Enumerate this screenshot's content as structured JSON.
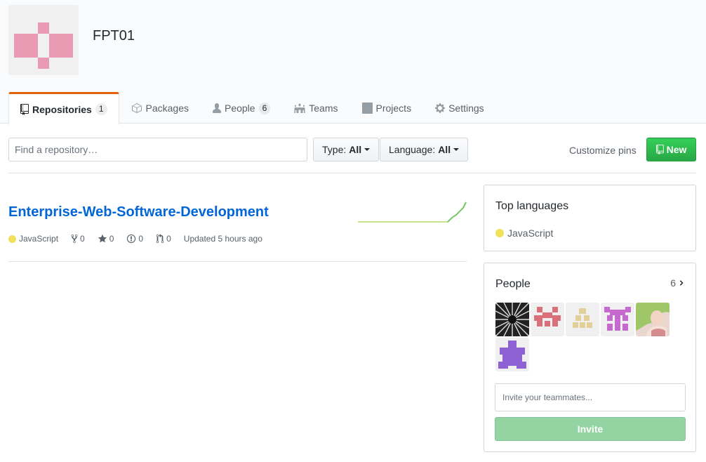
{
  "org": {
    "name": "FPT01",
    "avatar_icon": "identicon-pink"
  },
  "tabs": [
    {
      "label": "Repositories",
      "count": "1",
      "icon": "repo-icon",
      "selected": true
    },
    {
      "label": "Packages",
      "icon": "package-icon"
    },
    {
      "label": "People",
      "count": "6",
      "icon": "person-icon"
    },
    {
      "label": "Teams",
      "icon": "teams-icon"
    },
    {
      "label": "Projects",
      "icon": "project-icon"
    },
    {
      "label": "Settings",
      "icon": "gear-icon"
    }
  ],
  "filters": {
    "search_placeholder": "Find a repository…",
    "type_label": "Type:",
    "type_value": "All",
    "language_label": "Language:",
    "language_value": "All"
  },
  "actions": {
    "customize": "Customize pins",
    "new_button": "New"
  },
  "repo": {
    "name": "Enterprise-Web-Software-Development",
    "language": "JavaScript",
    "forks": "0",
    "stars": "0",
    "issues": "0",
    "pulls": "0",
    "updated": "Updated 5 hours ago"
  },
  "top_languages": {
    "title": "Top languages",
    "items": [
      {
        "name": "JavaScript",
        "color": "#f1e05a"
      }
    ]
  },
  "people": {
    "title": "People",
    "count": "6",
    "invite_placeholder": "Invite your teammates...",
    "invite_button": "Invite"
  },
  "colors": {
    "accent_tab": "#e36209",
    "link": "#0366d6",
    "primary_button": "#28a745",
    "invite_disabled": "#94d3a2"
  }
}
